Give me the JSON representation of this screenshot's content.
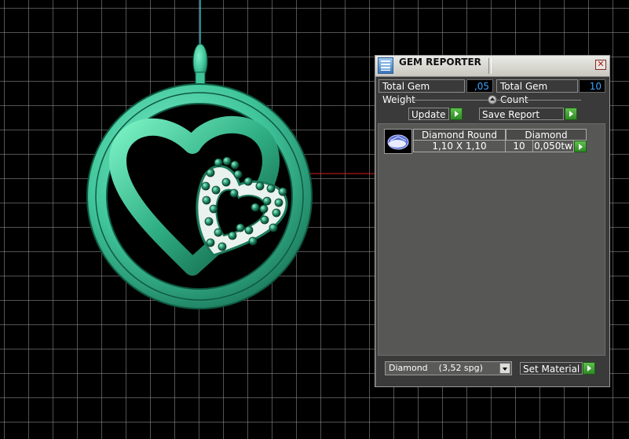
{
  "window": {
    "title": "GEM REPORTER",
    "close_symbol": "✕",
    "icon": "gem-reporter-icon"
  },
  "totals": {
    "weight_label": "Total Gem Weight",
    "weight_value": ",05",
    "count_label": "Total Gem Count",
    "count_value": "10"
  },
  "actions": {
    "update_label": "Update",
    "save_report_label": "Save Report"
  },
  "report": {
    "rows": [
      {
        "thumbnail": "gem-thumbnail-icon",
        "shape": "Diamond Round",
        "material": "Diamond",
        "size": "1,10 X 1,10",
        "count": "10",
        "weight": "0,050tw"
      }
    ]
  },
  "material": {
    "selected": "Diamond    (3,52 spg)",
    "set_label": "Set Material"
  },
  "colors": {
    "model": "#3fc49a",
    "model_dark": "#1b7a5c",
    "accent_green": "#3aa12f",
    "value_text": "#3aa4ff",
    "axis_red": "#d62020",
    "axis_cyan": "#28b7c8"
  }
}
